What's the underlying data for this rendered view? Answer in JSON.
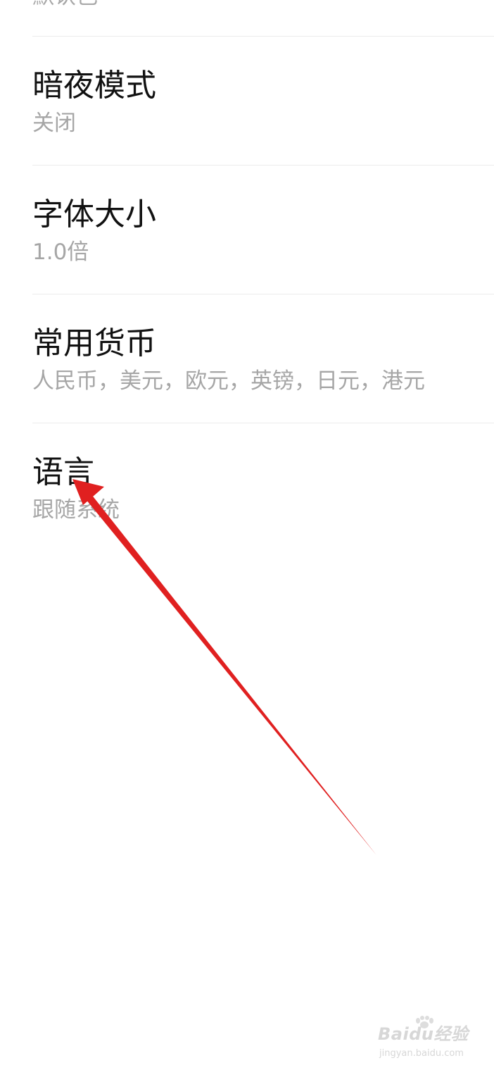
{
  "partial_item": {
    "value": "默认色"
  },
  "settings": [
    {
      "title": "暗夜模式",
      "value": "关闭"
    },
    {
      "title": "字体大小",
      "value": "1.0倍"
    },
    {
      "title": "常用货币",
      "value": "人民币，美元，欧元，英镑，日元，港元"
    },
    {
      "title": "语言",
      "value": "跟随系统"
    }
  ],
  "annotation": {
    "color": "#e02020"
  },
  "watermark": {
    "logo": "Baidu经验",
    "site": "jingyan.baidu.com"
  }
}
